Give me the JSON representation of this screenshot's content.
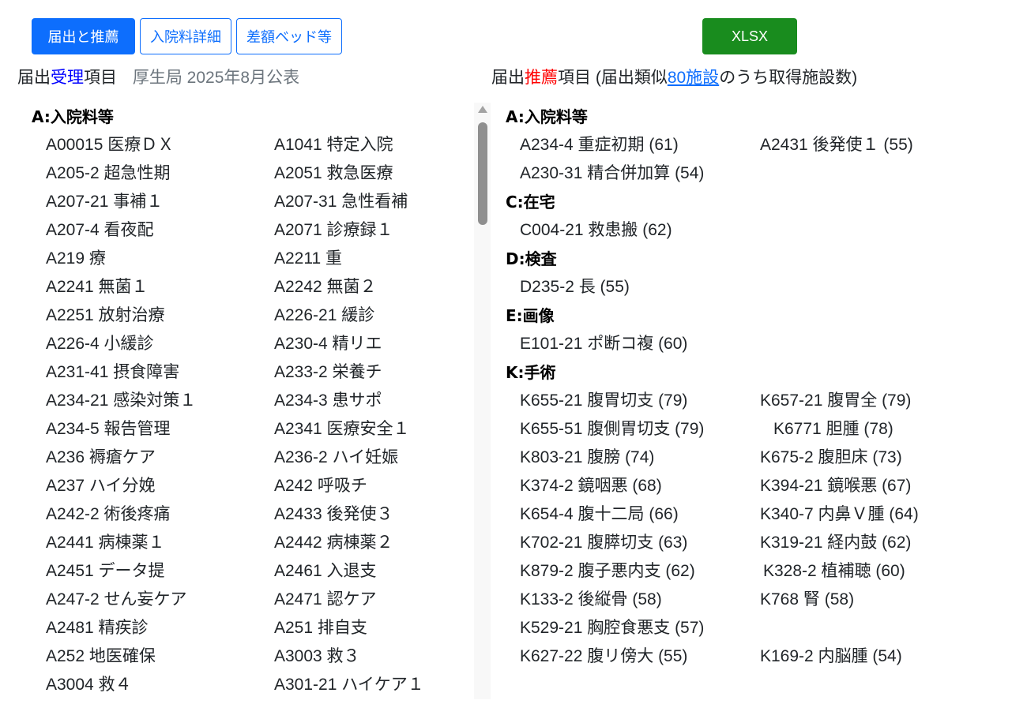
{
  "tabs": [
    {
      "label": "届出と推薦",
      "active": true
    },
    {
      "label": "入院料詳細",
      "active": false
    },
    {
      "label": "差額ベッド等",
      "active": false
    }
  ],
  "export_button": "XLSX",
  "left_heading": {
    "part1": "届出",
    "part2": "受理",
    "part3": "項目",
    "source": "厚生局 2025年8月公表"
  },
  "right_heading": {
    "part1": "届出",
    "part2": "推薦",
    "part3": "項目 (届出類似",
    "link": "80施設",
    "part4": "のうち取得施設数)"
  },
  "left_sections": [
    {
      "title": "A:入院料等",
      "items": [
        "A00015 医療ＤＸ",
        "A1041 特定入院",
        "A205-2 超急性期",
        "A2051 救急医療",
        "A207-21 事補１",
        "A207-31 急性看補",
        "A207-4 看夜配",
        "A2071 診療録１",
        "A219 療",
        "A2211 重",
        "A2241 無菌１",
        "A2242 無菌２",
        "A2251 放射治療",
        "A226-21 緩診",
        "A226-4 小緩診",
        "A230-4 精リエ",
        "A231-41 摂食障害",
        "A233-2 栄養チ",
        "A234-21 感染対策１",
        "A234-3 患サポ",
        "A234-5 報告管理",
        "A2341 医療安全１",
        "A236 褥瘡ケア",
        "A236-2 ハイ妊娠",
        "A237 ハイ分娩",
        "A242 呼吸チ",
        "A242-2 術後疼痛",
        "A2433 後発使３",
        "A2441 病棟薬１",
        "A2442 病棟薬２",
        "A2451 データ提",
        "A2461 入退支",
        "A247-2 せん妄ケア",
        "A2471 認ケア",
        "A2481 精疾診",
        "A251 排自支",
        "A252 地医確保",
        "A3003 救３",
        "A3004 救４",
        "A301-21 ハイケア１"
      ]
    }
  ],
  "right_sections": [
    {
      "title": "A:入院料等",
      "items": [
        "A234-4 重症初期 (61)",
        "A2431 後発使１ (55)",
        "A230-31 精合併加算 (54)"
      ]
    },
    {
      "title": "C:在宅",
      "items": [
        "C004-21 救患搬 (62)"
      ]
    },
    {
      "title": "D:検査",
      "items": [
        "D235-2 長 (55)"
      ]
    },
    {
      "title": "E:画像",
      "items": [
        "E101-21 ポ断コ複 (60)"
      ]
    },
    {
      "title": "K:手術",
      "items": [
        "K655-21 腹胃切支 (79)",
        "K657-21 腹胃全 (79)",
        "K655-51 腹側胃切支 (79)",
        "K6771 胆腫 (78)",
        "K803-21 腹膀 (74)",
        "K675-2 腹胆床 (73)",
        "K374-2 鏡咽悪 (68)",
        "K394-21 鏡喉悪 (67)",
        "K654-4 腹十二局 (66)",
        "K340-7 内鼻Ｖ腫 (64)",
        "K702-21 腹膵切支 (63)",
        "K319-21 経内鼓 (62)",
        "K879-2 腹子悪内支 (62)",
        "K328-2 植補聴 (60)",
        "K133-2 後縦骨 (58)",
        "K768 腎 (58)",
        "K529-21 胸腔食悪支 (57)",
        "K627-22 腹リ傍大 (55)",
        "K169-2 内脳腫 (54)"
      ]
    }
  ]
}
